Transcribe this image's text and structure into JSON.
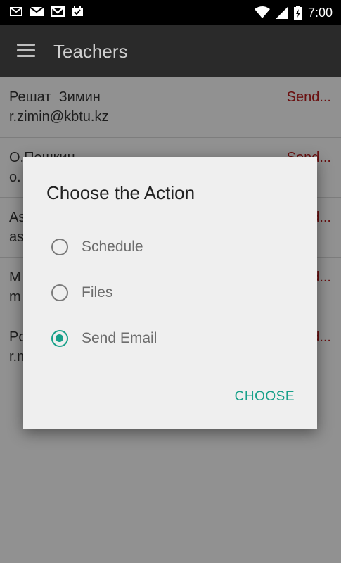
{
  "status_bar": {
    "time": "7:00",
    "left_icons": [
      "mail-outline-icon",
      "email-icon",
      "gmail-icon",
      "calendar-check-icon"
    ],
    "right_icons": [
      "wifi-icon",
      "signal-icon",
      "battery-charging-icon"
    ]
  },
  "app_bar": {
    "title": "Teachers",
    "menu_icon": "hamburger-menu-icon"
  },
  "teachers": [
    {
      "name": "Решат  Зимин",
      "email": "r.zimin@kbtu.kz",
      "action": "Send..."
    },
    {
      "name": "О.Пешкин",
      "email": "o.",
      "action": "Send..."
    },
    {
      "name": "As",
      "email": "as",
      "action": "Send..."
    },
    {
      "name": "M",
      "email": "m",
      "action": "Send..."
    },
    {
      "name": "Po",
      "email": "r.n",
      "action": "Send..."
    }
  ],
  "dialog": {
    "title": "Choose the Action",
    "options": [
      {
        "label": "Schedule",
        "selected": false
      },
      {
        "label": "Files",
        "selected": false
      },
      {
        "label": "Send Email",
        "selected": true
      }
    ],
    "confirm_label": "CHOOSE"
  },
  "colors": {
    "accent": "#17a089",
    "send_link": "#b71c1c",
    "app_bar": "#2a2a2a",
    "status_bar": "#000000"
  }
}
